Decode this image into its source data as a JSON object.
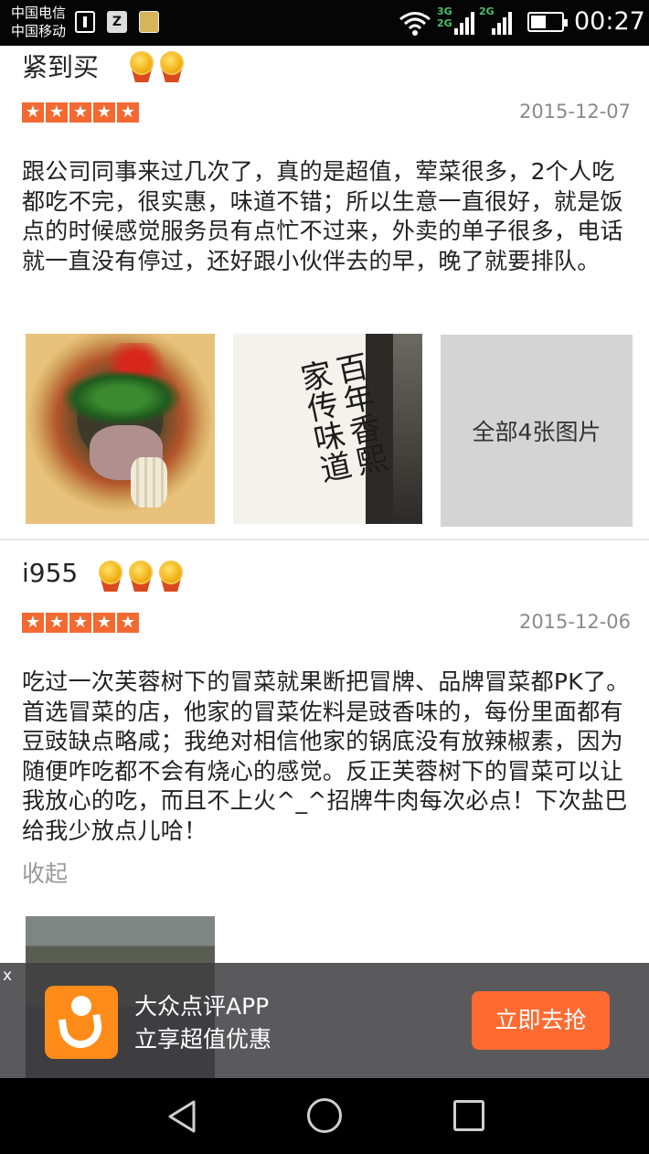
{
  "status_bar": {
    "carrier_1": "中国电信",
    "carrier_2": "中国移动",
    "net_1": "3G",
    "net_2": "2G",
    "net_3": "2G",
    "battery_level_pct": 50,
    "time": "00:27"
  },
  "reviews": [
    {
      "reviewer": "紧到买",
      "medal_count": 2,
      "star_rating": 5,
      "date": "2015-12-07",
      "content": "跟公司同事来过几次了，真的是超值，荤菜很多，2个人吃都吃不完，很实惠，味道不错；所以生意一直很好，就是饭点的时候感觉服务员有点忙不过来，外卖的单子很多，电话就一直没有停过，还好跟小伙伴去的早，晚了就要排队。",
      "all_photos_label": "全部4张图片"
    },
    {
      "reviewer": "i955",
      "medal_count": 3,
      "star_rating": 5,
      "date": "2015-12-06",
      "content": "吃过一次芙蓉树下的冒菜就果断把冒牌、品牌冒菜都PK了。首选冒菜的店，他家的冒菜佐料是豉香味的，每份里面都有豆豉缺点略咸；我绝对相信他家的锅底没有放辣椒素，因为随便咋吃都不会有烧心的感觉。反正芙蓉树下的冒菜可以让我放心的吃，而且不上火^_^招牌牛肉每次必点！下次盐巴给我少放点儿哈！",
      "collapse_label": "收起"
    }
  ],
  "banner": {
    "close_label": "x",
    "title": "大众点评APP",
    "subtitle": "立享超值优惠",
    "button_label": "立即去抢"
  },
  "icons": {
    "star": "★",
    "sign_text": "百年香熙家传味道"
  },
  "colors": {
    "star": "#f26a32",
    "button": "#ff6a30",
    "logo": "#ff8c1a",
    "date": "#8a8a8a"
  }
}
